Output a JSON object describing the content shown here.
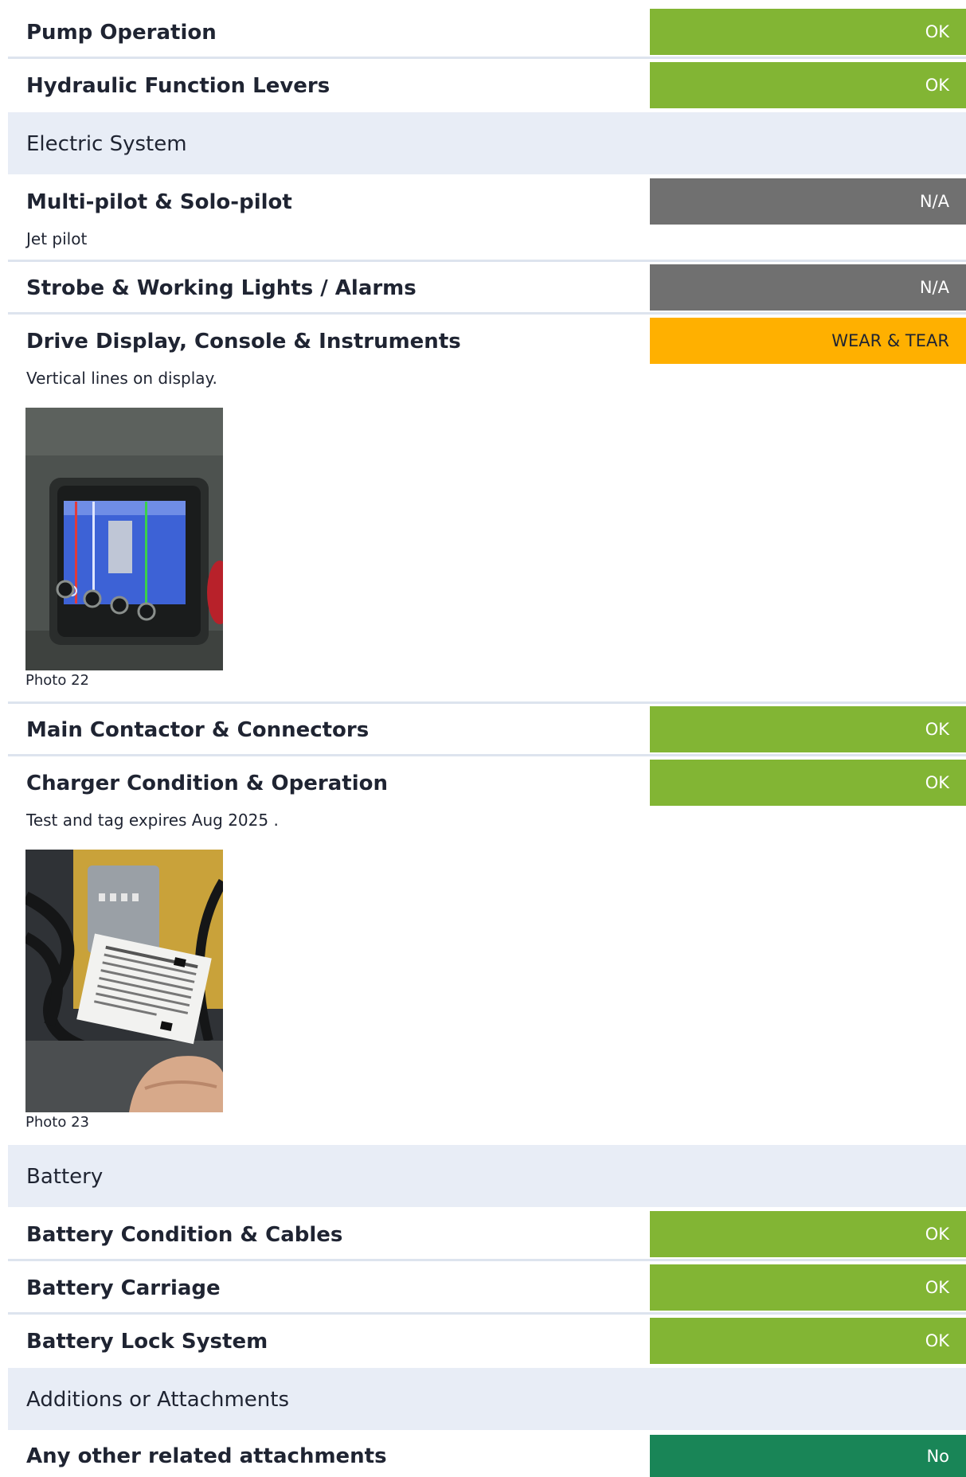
{
  "items": {
    "pump_operation": {
      "title": "Pump Operation",
      "status": "OK"
    },
    "hydraulic_levers": {
      "title": "Hydraulic Function Levers",
      "status": "OK"
    },
    "multi_pilot": {
      "title": "Multi-pilot & Solo-pilot",
      "status": "N/A",
      "note": "Jet pilot"
    },
    "strobe_lights": {
      "title": "Strobe & Working Lights / Alarms",
      "status": "N/A"
    },
    "drive_display": {
      "title": "Drive Display, Console & Instruments",
      "status": "WEAR & TEAR",
      "note": "Vertical lines on display.",
      "photo_caption": "Photo 22"
    },
    "main_contactor": {
      "title": "Main Contactor & Connectors",
      "status": "OK"
    },
    "charger": {
      "title": "Charger Condition & Operation",
      "status": "OK",
      "note": "Test and tag expires Aug 2025 .",
      "photo_caption": "Photo 23"
    },
    "battery_condition": {
      "title": "Battery Condition & Cables",
      "status": "OK"
    },
    "battery_carriage": {
      "title": "Battery Carriage",
      "status": "OK"
    },
    "battery_lock": {
      "title": "Battery Lock System",
      "status": "OK"
    },
    "other_attachments": {
      "title": "Any other related attachments",
      "status": "No"
    }
  },
  "sections": {
    "electric": "Electric System",
    "battery": "Battery",
    "additions": "Additions or Attachments"
  },
  "colors": {
    "ok": "#82b534",
    "na": "#707070",
    "wear": "#ffb000",
    "no": "#198557",
    "section_bg": "#e8edf6"
  }
}
